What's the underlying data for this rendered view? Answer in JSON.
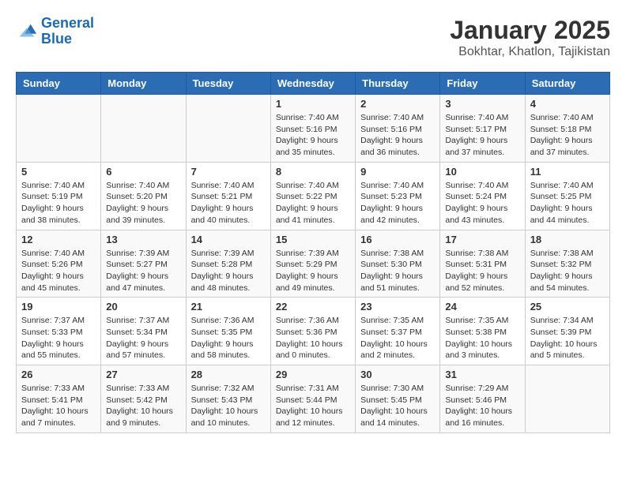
{
  "logo": {
    "line1": "General",
    "line2": "Blue"
  },
  "title": "January 2025",
  "subtitle": "Bokhtar, Khatlon, Tajikistan",
  "days_of_week": [
    "Sunday",
    "Monday",
    "Tuesday",
    "Wednesday",
    "Thursday",
    "Friday",
    "Saturday"
  ],
  "weeks": [
    [
      {
        "day": "",
        "info": ""
      },
      {
        "day": "",
        "info": ""
      },
      {
        "day": "",
        "info": ""
      },
      {
        "day": "1",
        "info": "Sunrise: 7:40 AM\nSunset: 5:16 PM\nDaylight: 9 hours and 35 minutes."
      },
      {
        "day": "2",
        "info": "Sunrise: 7:40 AM\nSunset: 5:16 PM\nDaylight: 9 hours and 36 minutes."
      },
      {
        "day": "3",
        "info": "Sunrise: 7:40 AM\nSunset: 5:17 PM\nDaylight: 9 hours and 37 minutes."
      },
      {
        "day": "4",
        "info": "Sunrise: 7:40 AM\nSunset: 5:18 PM\nDaylight: 9 hours and 37 minutes."
      }
    ],
    [
      {
        "day": "5",
        "info": "Sunrise: 7:40 AM\nSunset: 5:19 PM\nDaylight: 9 hours and 38 minutes."
      },
      {
        "day": "6",
        "info": "Sunrise: 7:40 AM\nSunset: 5:20 PM\nDaylight: 9 hours and 39 minutes."
      },
      {
        "day": "7",
        "info": "Sunrise: 7:40 AM\nSunset: 5:21 PM\nDaylight: 9 hours and 40 minutes."
      },
      {
        "day": "8",
        "info": "Sunrise: 7:40 AM\nSunset: 5:22 PM\nDaylight: 9 hours and 41 minutes."
      },
      {
        "day": "9",
        "info": "Sunrise: 7:40 AM\nSunset: 5:23 PM\nDaylight: 9 hours and 42 minutes."
      },
      {
        "day": "10",
        "info": "Sunrise: 7:40 AM\nSunset: 5:24 PM\nDaylight: 9 hours and 43 minutes."
      },
      {
        "day": "11",
        "info": "Sunrise: 7:40 AM\nSunset: 5:25 PM\nDaylight: 9 hours and 44 minutes."
      }
    ],
    [
      {
        "day": "12",
        "info": "Sunrise: 7:40 AM\nSunset: 5:26 PM\nDaylight: 9 hours and 45 minutes."
      },
      {
        "day": "13",
        "info": "Sunrise: 7:39 AM\nSunset: 5:27 PM\nDaylight: 9 hours and 47 minutes."
      },
      {
        "day": "14",
        "info": "Sunrise: 7:39 AM\nSunset: 5:28 PM\nDaylight: 9 hours and 48 minutes."
      },
      {
        "day": "15",
        "info": "Sunrise: 7:39 AM\nSunset: 5:29 PM\nDaylight: 9 hours and 49 minutes."
      },
      {
        "day": "16",
        "info": "Sunrise: 7:38 AM\nSunset: 5:30 PM\nDaylight: 9 hours and 51 minutes."
      },
      {
        "day": "17",
        "info": "Sunrise: 7:38 AM\nSunset: 5:31 PM\nDaylight: 9 hours and 52 minutes."
      },
      {
        "day": "18",
        "info": "Sunrise: 7:38 AM\nSunset: 5:32 PM\nDaylight: 9 hours and 54 minutes."
      }
    ],
    [
      {
        "day": "19",
        "info": "Sunrise: 7:37 AM\nSunset: 5:33 PM\nDaylight: 9 hours and 55 minutes."
      },
      {
        "day": "20",
        "info": "Sunrise: 7:37 AM\nSunset: 5:34 PM\nDaylight: 9 hours and 57 minutes."
      },
      {
        "day": "21",
        "info": "Sunrise: 7:36 AM\nSunset: 5:35 PM\nDaylight: 9 hours and 58 minutes."
      },
      {
        "day": "22",
        "info": "Sunrise: 7:36 AM\nSunset: 5:36 PM\nDaylight: 10 hours and 0 minutes."
      },
      {
        "day": "23",
        "info": "Sunrise: 7:35 AM\nSunset: 5:37 PM\nDaylight: 10 hours and 2 minutes."
      },
      {
        "day": "24",
        "info": "Sunrise: 7:35 AM\nSunset: 5:38 PM\nDaylight: 10 hours and 3 minutes."
      },
      {
        "day": "25",
        "info": "Sunrise: 7:34 AM\nSunset: 5:39 PM\nDaylight: 10 hours and 5 minutes."
      }
    ],
    [
      {
        "day": "26",
        "info": "Sunrise: 7:33 AM\nSunset: 5:41 PM\nDaylight: 10 hours and 7 minutes."
      },
      {
        "day": "27",
        "info": "Sunrise: 7:33 AM\nSunset: 5:42 PM\nDaylight: 10 hours and 9 minutes."
      },
      {
        "day": "28",
        "info": "Sunrise: 7:32 AM\nSunset: 5:43 PM\nDaylight: 10 hours and 10 minutes."
      },
      {
        "day": "29",
        "info": "Sunrise: 7:31 AM\nSunset: 5:44 PM\nDaylight: 10 hours and 12 minutes."
      },
      {
        "day": "30",
        "info": "Sunrise: 7:30 AM\nSunset: 5:45 PM\nDaylight: 10 hours and 14 minutes."
      },
      {
        "day": "31",
        "info": "Sunrise: 7:29 AM\nSunset: 5:46 PM\nDaylight: 10 hours and 16 minutes."
      },
      {
        "day": "",
        "info": ""
      }
    ]
  ]
}
